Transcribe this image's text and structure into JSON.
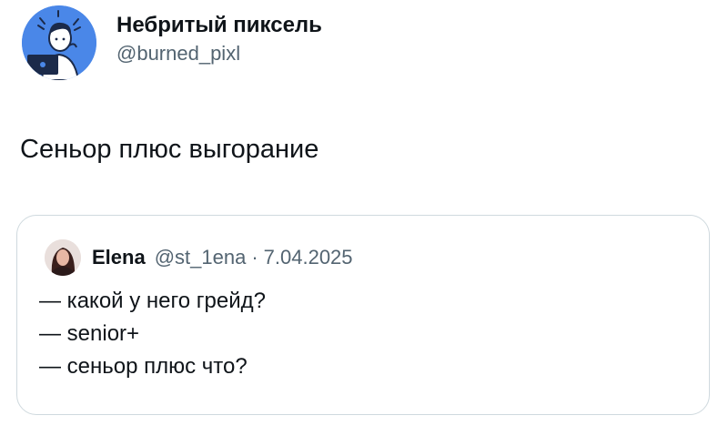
{
  "author": {
    "display_name": "Небритый пиксель",
    "handle": "@burned_pixl",
    "avatar_icon": "developer-with-laptop-icon",
    "avatar_color": "#4a87e8"
  },
  "tweet_text": "Сеньор плюс выгорание",
  "quoted_tweet": {
    "author_name": "Elena",
    "handle": "@st_1ena",
    "separator": "·",
    "date": "7.04.2025",
    "lines": [
      "— какой у него грейд?",
      "— senior+",
      "— сеньор плюс что?"
    ]
  },
  "colors": {
    "text": "#0f1419",
    "secondary_text": "#536471",
    "card_border": "#cfd9de"
  }
}
